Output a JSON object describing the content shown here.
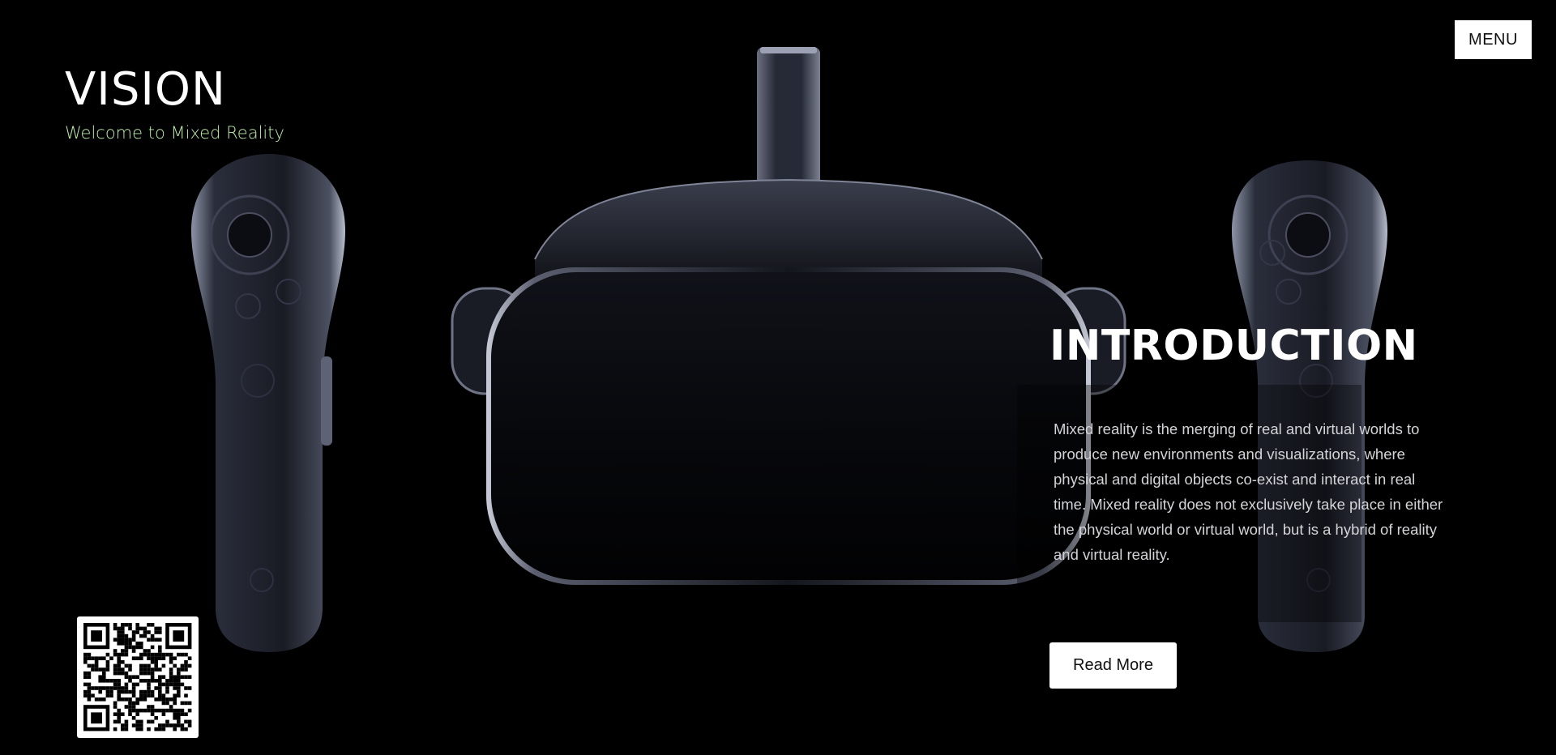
{
  "brand": {
    "title": "VISION",
    "subtitle": "Welcome to Mixed Reality"
  },
  "menu": {
    "label": "MENU"
  },
  "intro": {
    "heading": "INTRODUCTION",
    "body": "Mixed reality is the merging of real and virtual worlds to produce new environments and visualizations, where physical and digital objects co-exist and interact in real time. Mixed reality does not exclusively take place in either the physical world or virtual world, but is a hybrid of reality and virtual reality.",
    "button_label": "Read More"
  },
  "hero": {
    "icons": [
      "vr-headset-image",
      "left-controller-image",
      "right-controller-image"
    ]
  },
  "qr": {
    "icon": "qr-code-icon"
  },
  "colors": {
    "background": "#000000",
    "subtitle": "#b9eaa8",
    "button_bg": "#ffffff",
    "body_text": "#d4d4d8"
  }
}
